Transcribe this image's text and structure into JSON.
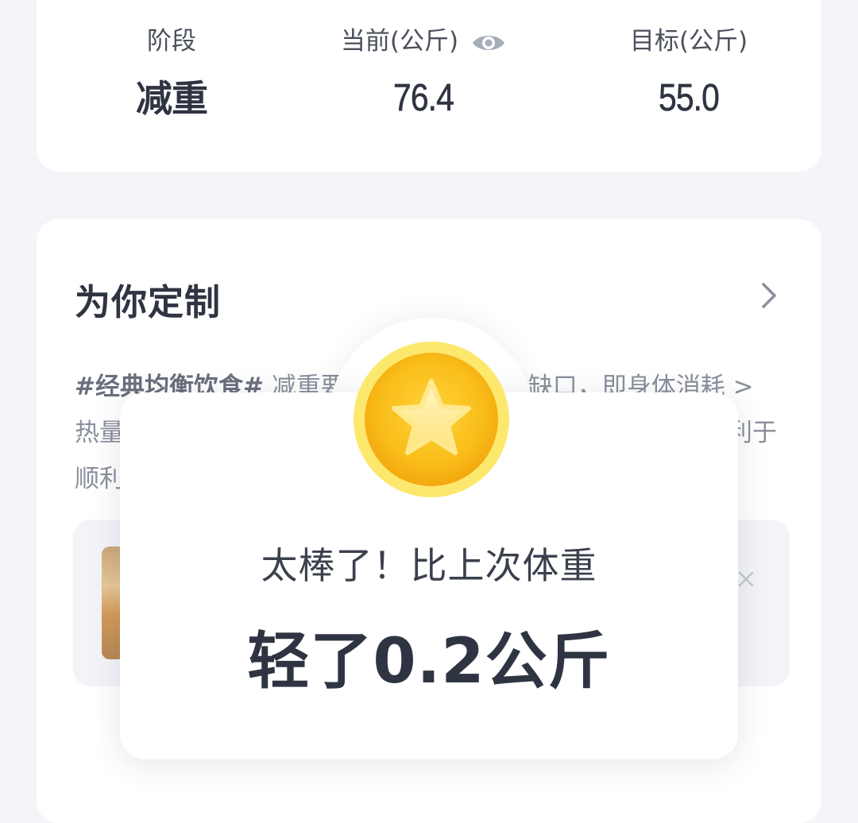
{
  "stats": {
    "stage_label": "阶段",
    "stage_value": "减重",
    "current_label": "当前(公斤)",
    "current_value": "76.4",
    "target_label": "目标(公斤)",
    "target_value": "55.0",
    "eye_icon": "eye-icon"
  },
  "custom": {
    "title": "为你定制",
    "chevron_icon": "chevron-right-icon",
    "desc_tag": "#经典均衡饮食#",
    "desc_line1_rest": " 减重要",
    "desc_line1_tail": "缺口，即身体消耗 >",
    "desc_line2_head": "热量",
    "desc_line2_tail": "利于",
    "desc_line3_head": "顺利",
    "close_icon": "close-icon"
  },
  "popup": {
    "coin_icon": "star-coin-icon",
    "line1": "太棒了！比上次体重",
    "line2": "轻了0.2公斤"
  },
  "colors": {
    "background": "#f4f5f8",
    "card": "#ffffff",
    "text_dark": "#2f3442",
    "text_muted": "#8a8f9c",
    "coin_gold": "#f7c21f",
    "coin_rim": "#fde46a"
  }
}
